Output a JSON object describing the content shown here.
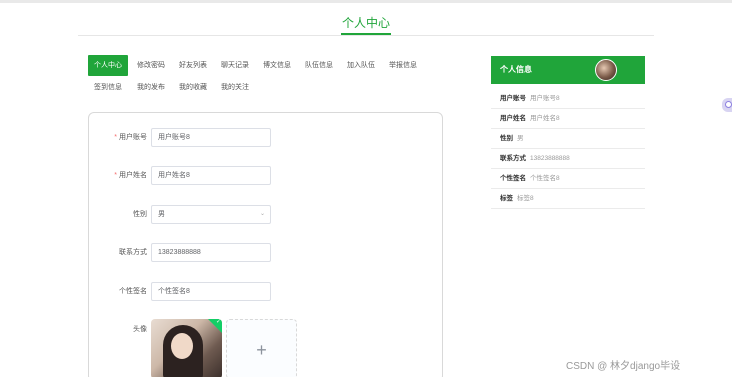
{
  "header": {
    "title": "个人中心"
  },
  "tabs": [
    {
      "label": "个人中心",
      "active": true
    },
    {
      "label": "修改密码",
      "active": false
    },
    {
      "label": "好友列表",
      "active": false
    },
    {
      "label": "聊天记录",
      "active": false
    },
    {
      "label": "博文信息",
      "active": false
    },
    {
      "label": "队伍信息",
      "active": false
    },
    {
      "label": "加入队伍",
      "active": false
    },
    {
      "label": "举报信息",
      "active": false
    },
    {
      "label": "签到信息",
      "active": false
    },
    {
      "label": "我的发布",
      "active": false
    },
    {
      "label": "我的收藏",
      "active": false
    },
    {
      "label": "我的关注",
      "active": false
    }
  ],
  "form": {
    "account": {
      "label": "用户账号",
      "required": true,
      "value": "用户账号8"
    },
    "name": {
      "label": "用户姓名",
      "required": true,
      "value": "用户姓名8"
    },
    "gender": {
      "label": "性别",
      "value": "男"
    },
    "phone": {
      "label": "联系方式",
      "value": "13823888888"
    },
    "signature": {
      "label": "个性签名",
      "value": "个性签名8"
    },
    "avatar": {
      "label": "头像",
      "upload_symbol": "+"
    }
  },
  "info_panel": {
    "title": "个人信息",
    "rows": [
      {
        "key": "用户账号",
        "value": "用户账号8"
      },
      {
        "key": "用户姓名",
        "value": "用户姓名8"
      },
      {
        "key": "性别",
        "value": "男"
      },
      {
        "key": "联系方式",
        "value": "13823888888"
      },
      {
        "key": "个性签名",
        "value": "个性签名8"
      },
      {
        "key": "标签",
        "value": "标签8"
      }
    ]
  },
  "watermark": "CSDN @ 林夕django毕设",
  "colors": {
    "accent": "#20a53a",
    "required": "#f56c6c",
    "border": "#dcdfe6"
  }
}
